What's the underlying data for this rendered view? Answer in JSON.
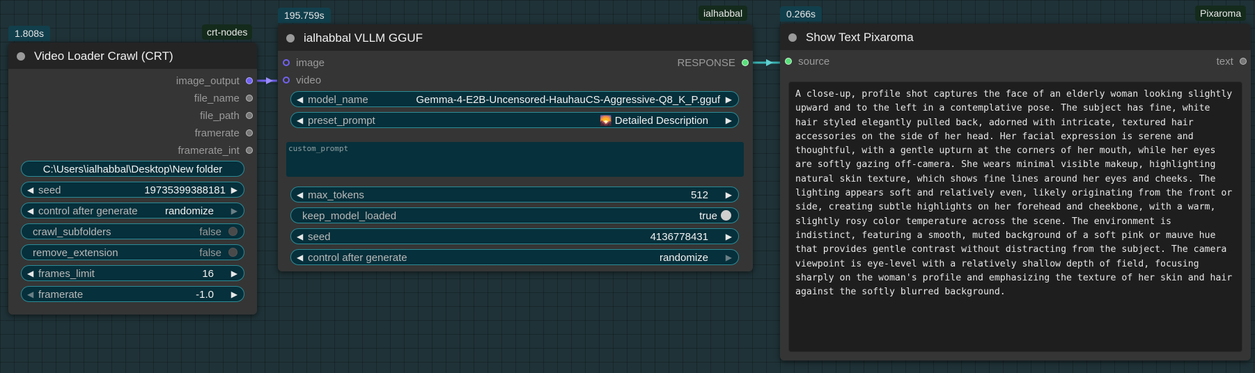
{
  "node1": {
    "time": "1.808s",
    "tag": "crt-nodes",
    "title": "Video Loader Crawl (CRT)",
    "outputs": [
      "image_output",
      "file_name",
      "file_path",
      "framerate",
      "framerate_int"
    ],
    "path_value": "C:\\Users\\ialhabbal\\Desktop\\New folder",
    "seed_label": "seed",
    "seed_value": "19735399388181",
    "control_label": "control after generate",
    "control_value": "randomize",
    "crawl_label": "crawl_subfolders",
    "crawl_value": "false",
    "remove_label": "remove_extension",
    "remove_value": "false",
    "frames_label": "frames_limit",
    "frames_value": "16",
    "framerate_label": "framerate",
    "framerate_value": "-1.0"
  },
  "node2": {
    "time": "195.759s",
    "tag": "ialhabbal",
    "title": "ialhabbal VLLM GGUF",
    "input_image": "image",
    "input_video": "video",
    "output_response": "RESPONSE",
    "model_label": "model_name",
    "model_value": "Gemma-4-E2B-Uncensored-HauhauCS-Aggressive-Q8_K_P.gguf",
    "preset_label": "preset_prompt",
    "preset_icon": "🌄",
    "preset_value": "Detailed Description",
    "custom_placeholder": "custom_prompt",
    "max_tokens_label": "max_tokens",
    "max_tokens_value": "512",
    "keep_label": "keep_model_loaded",
    "keep_value": "true",
    "seed_label": "seed",
    "seed_value": "4136778431",
    "control_label": "control after generate",
    "control_value": "randomize"
  },
  "node3": {
    "time": "0.266s",
    "tag": "Pixaroma",
    "title": "Show Text Pixaroma",
    "input_source": "source",
    "output_text": "text",
    "text": "A close-up, profile shot captures the face of an elderly woman looking slightly upward and to the left in a contemplative pose. The subject has fine, white hair styled elegantly pulled back, adorned with intricate, textured hair accessories on the side of her head. Her facial expression is serene and thoughtful, with a gentle upturn at the corners of her mouth, while her eyes are softly gazing off-camera. She wears minimal visible makeup, highlighting natural skin texture, which shows fine lines around her eyes and cheeks. The lighting appears soft and relatively even, likely originating from the front or side, creating subtle highlights on her forehead and cheekbone, with a warm, slightly rosy color temperature across the scene. The environment is indistinct, featuring a smooth, muted background of a soft pink or mauve hue that provides gentle contrast without distracting from the subject. The camera viewpoint is eye-level with a relatively shallow depth of field, focusing sharply on the woman's profile and emphasizing the texture of her skin and hair against the softly blurred background."
  },
  "colors": {
    "canvas": "#1f3237",
    "node_body": "#353535",
    "node_header": "#242424",
    "widget_bg": "#06303b",
    "widget_border": "#2c8a96",
    "image_link": "#7262f0",
    "string_link": "#3ab5b5"
  }
}
